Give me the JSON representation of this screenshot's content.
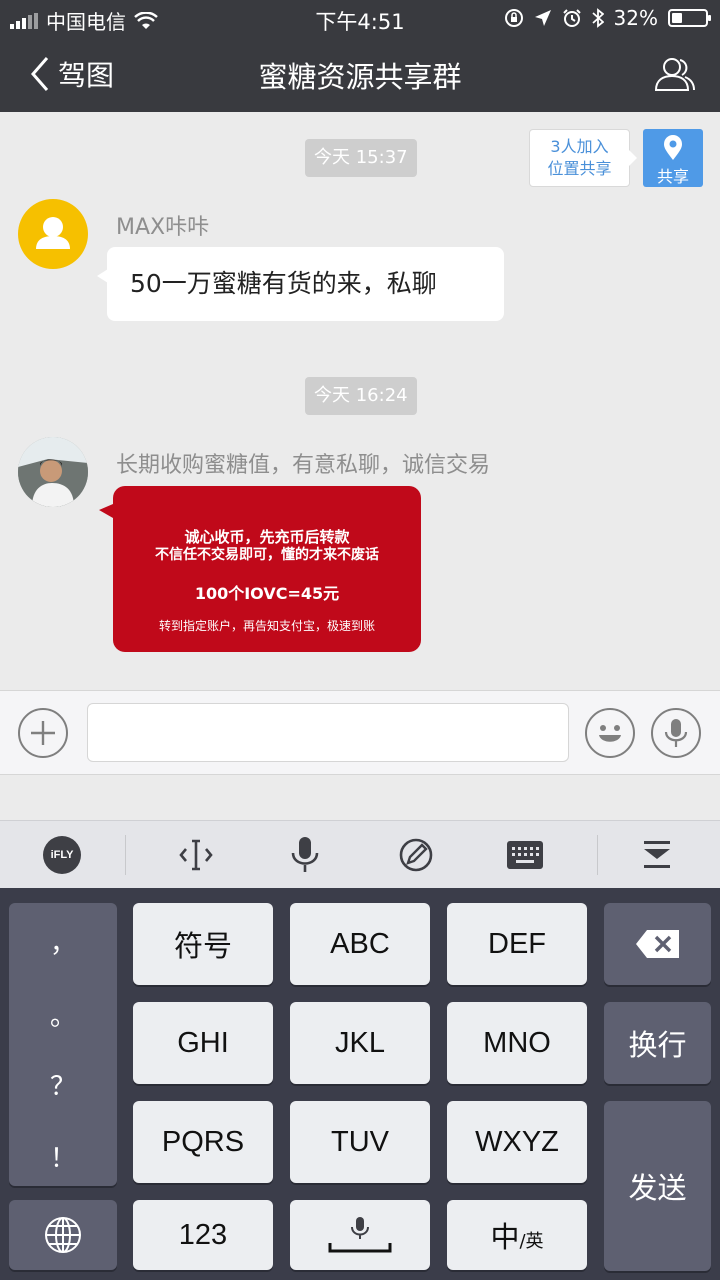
{
  "status_bar": {
    "carrier": "中国电信",
    "time": "下午4:51",
    "battery": "32%",
    "battery_level": 0.32
  },
  "nav": {
    "back_label": "驾图",
    "title": "蜜糖资源共享群",
    "members_icon": "group-members-icon"
  },
  "chat": {
    "location_tip": {
      "line1": "3人加入",
      "line2": "位置共享"
    },
    "location_share_label": "共享",
    "messages": [
      {
        "time": "今天 15:37",
        "sender": "MAX咔咔",
        "text": "50一万蜜糖有货的来，私聊"
      },
      {
        "time": "今天 16:24",
        "sender": "长期收购蜜糖值，有意私聊，诚信交易",
        "image": {
          "line1": "诚心收币，先充币后转款",
          "line2": "不信任不交易即可，懂的才来不废话",
          "line3": "100个IOVC=45元",
          "line4": "转到指定账户，再告知支付宝，极速到账"
        }
      }
    ]
  },
  "input_bar": {
    "value": "",
    "placeholder": ""
  },
  "keyboard_toolbar": {
    "ifly_label": "iFLY"
  },
  "keyboard": {
    "punctuation": [
      "，",
      "。",
      "？",
      "！"
    ],
    "rows": [
      [
        "符号",
        "ABC",
        "DEF"
      ],
      [
        "GHI",
        "JKL",
        "MNO"
      ],
      [
        "PQRS",
        "TUV",
        "WXYZ"
      ]
    ],
    "key_123": "123",
    "key_lang_main": "中",
    "key_lang_sub": "/英",
    "key_newline": "换行",
    "key_send": "发送"
  },
  "colors": {
    "header_bg": "#393a3f",
    "chat_bg": "#ebebeb",
    "accent_blue": "#4f9ae7",
    "image_red": "#c0091a",
    "keyboard_bg": "#3b3d4a"
  }
}
